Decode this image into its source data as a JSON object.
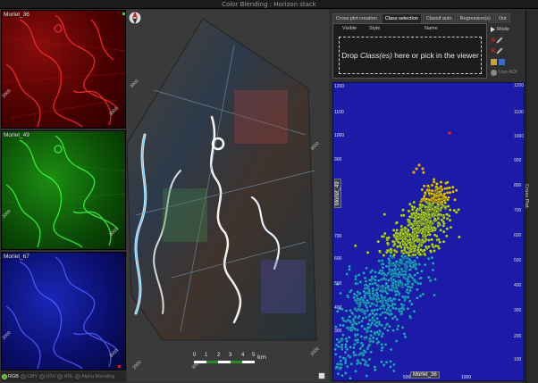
{
  "window": {
    "title": "Color Blending : Horizon stack"
  },
  "channels": [
    {
      "label": "Morlet_36",
      "color": "#ff2020",
      "ticks": [
        "2000",
        "3000"
      ]
    },
    {
      "label": "Morlet_49",
      "color": "#20ff20",
      "ticks": [
        "2000",
        "3000"
      ]
    },
    {
      "label": "Morlet_67",
      "color": "#3040ff",
      "ticks": [
        "2000",
        "3000"
      ]
    }
  ],
  "color_modes": {
    "items": [
      {
        "label": "RGB",
        "active": true
      },
      {
        "label": "CMY",
        "active": false
      },
      {
        "label": "HSV",
        "active": false
      },
      {
        "label": "HSL",
        "active": false
      },
      {
        "label": "Alpha Blending",
        "active": false
      }
    ]
  },
  "viewer": {
    "axis_ticks": [
      "3000",
      "3000",
      "2000",
      "2000",
      "3000"
    ],
    "scalebar": {
      "numbers": [
        "0",
        "1",
        "2",
        "3",
        "4",
        "5"
      ],
      "unit": "km"
    },
    "compass_icon": "compass-icon"
  },
  "panel": {
    "tabs": [
      {
        "label": "Cross plot creation",
        "active": false
      },
      {
        "label": "Class selection",
        "active": true
      },
      {
        "label": "Classif auto",
        "active": false
      },
      {
        "label": "Regression(s)",
        "active": false
      },
      {
        "label": "Out",
        "active": false
      }
    ],
    "columns": [
      "Visible",
      "Style",
      "Name"
    ],
    "drop_text_before": "Drop ",
    "drop_text_em": "Class(es)",
    "drop_text_after": " here or pick in the viewer",
    "mode_label": "Mode",
    "use_aoi_label": "Use AOI"
  },
  "crossplot": {
    "side_label": "Cross Plot",
    "x_label": "Morlet_36",
    "y_label": "Morlet_49",
    "x_ticks": [
      "500",
      "1000"
    ],
    "y_ticks": [
      "1200",
      "1100",
      "1000",
      "900",
      "800",
      "700",
      "600",
      "500",
      "400",
      "300"
    ],
    "outer_y_ticks": [
      "1200",
      "1100",
      "1000",
      "900",
      "800",
      "700",
      "600",
      "500",
      "400",
      "300",
      "200",
      "100"
    ],
    "colors": {
      "background": "#1b1ba8",
      "outlier": "#e02020",
      "high": "#f0d000",
      "mid": "#b8e020",
      "low": "#20a8d8"
    }
  }
}
